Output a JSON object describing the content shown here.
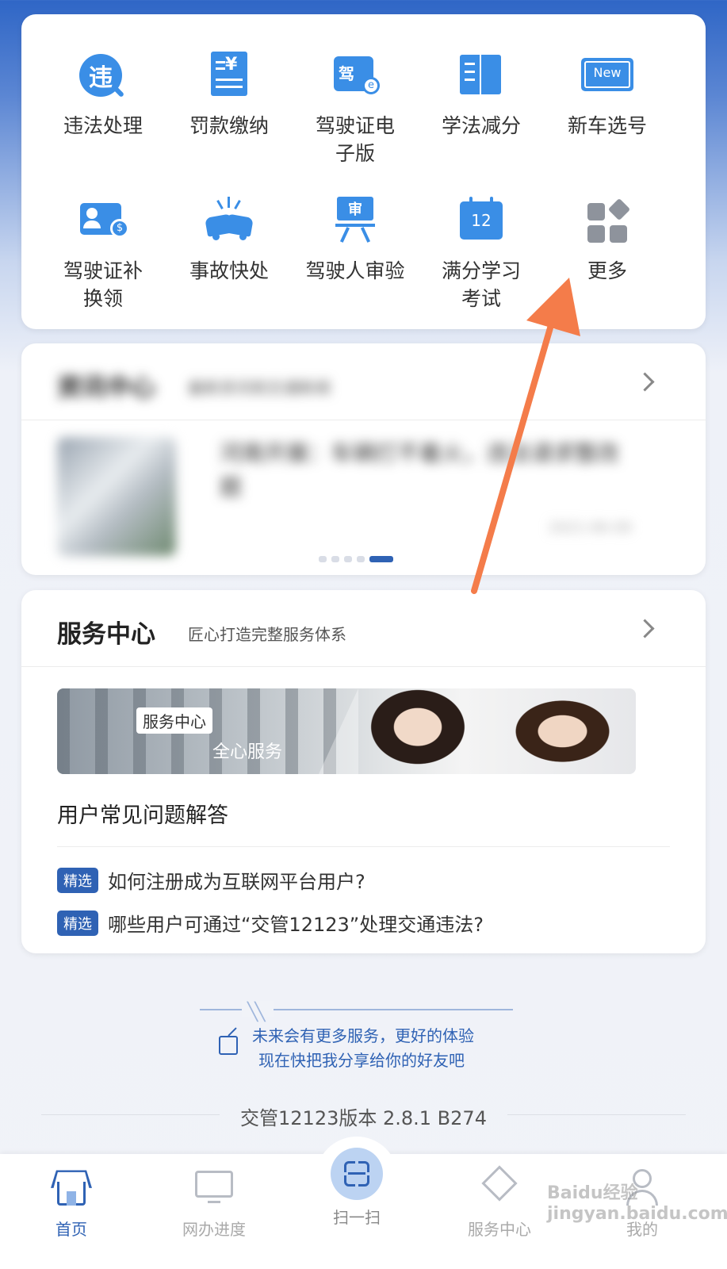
{
  "services": [
    {
      "label": "违法处理",
      "icon": "violation-icon",
      "glyph": "违"
    },
    {
      "label": "罚款缴纳",
      "icon": "fine-receipt-icon",
      "glyph": "¥"
    },
    {
      "label": "驾驶证电\n子版",
      "icon": "e-license-icon",
      "glyph": "驾"
    },
    {
      "label": "学法减分",
      "icon": "book-icon",
      "glyph": ""
    },
    {
      "label": "新车选号",
      "icon": "new-plate-icon",
      "glyph": "New"
    },
    {
      "label": "驾驶证补\n换领",
      "icon": "license-renew-icon",
      "glyph": ""
    },
    {
      "label": "事故快处",
      "icon": "accident-icon",
      "glyph": ""
    },
    {
      "label": "驾驶人审验",
      "icon": "driver-review-icon",
      "glyph": "审"
    },
    {
      "label": "满分学习\n考试",
      "icon": "calendar-exam-icon",
      "glyph": "12"
    },
    {
      "label": "更多",
      "icon": "more-grid-icon",
      "glyph": ""
    }
  ],
  "news": {
    "title": "资讯中心",
    "subtitle": "最新资讯和交通新闻",
    "headline": "河南开展：车辆打不着火，违法请求整改",
    "headline_cont": "题",
    "date": "2021-06-09",
    "carousel_count": 5,
    "carousel_active": 4
  },
  "service_center": {
    "title": "服务中心",
    "subtitle": "匠心打造完整服务体系",
    "banner_tag": "服务中心",
    "banner_caption": "全心服务",
    "faq_title": "用户常见问题解答",
    "faq": [
      {
        "badge": "精选",
        "text": "如何注册成为互联网平台用户?"
      },
      {
        "badge": "精选",
        "text": "哪些用户可通过“交管12123”处理交通违法?"
      }
    ]
  },
  "share": {
    "line1": "未来会有更多服务，更好的体验",
    "line2": "现在快把我分享给你的好友吧"
  },
  "version": "交管12123版本 2.8.1 B274",
  "nav": [
    {
      "label": "首页",
      "icon": "home-icon"
    },
    {
      "label": "网办进度",
      "icon": "monitor-icon"
    },
    {
      "label": "扫一扫",
      "icon": "scan-icon"
    },
    {
      "label": "服务中心",
      "icon": "service-icon"
    },
    {
      "label": "我的",
      "icon": "user-icon"
    }
  ],
  "watermark": "Baidu经验 jingyan.baidu.com",
  "colors": {
    "primary": "#2f62b4",
    "accent_arrow": "#f47c4a",
    "icon_blue": "#3a8ee6"
  }
}
